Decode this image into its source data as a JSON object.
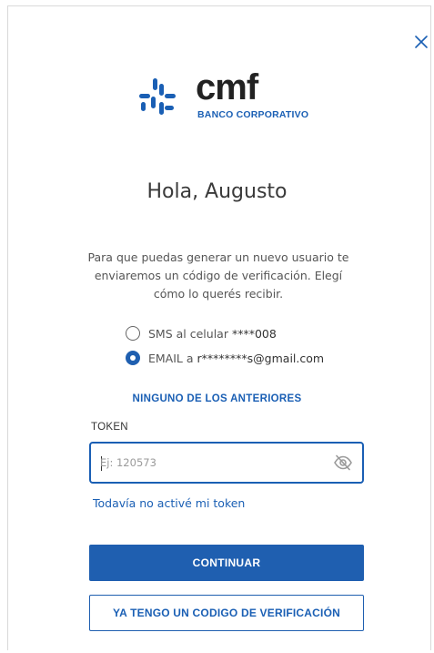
{
  "brand": {
    "name": "cmf",
    "subtitle": "BANCO CORPORATIVO",
    "color": "#1a5fb4"
  },
  "greeting": "Hola, Augusto",
  "description": "Para que puedas generar un nuevo usuario te enviaremos un código de verificación. Elegí cómo lo querés recibir.",
  "options": [
    {
      "label": "SMS al celular",
      "value": "****008",
      "selected": false
    },
    {
      "label": "EMAIL a",
      "value": "r********s@gmail.com",
      "selected": true
    }
  ],
  "none_option_label": "NINGUNO DE LOS ANTERIORES",
  "token": {
    "label": "TOKEN",
    "placeholder": "Ej: 120573",
    "value": ""
  },
  "no_token_link": "Todavía no activé mi token",
  "buttons": {
    "continue": "CONTINUAR",
    "have_code": "YA TENGO UN CODIGO DE VERIFICACIÓN"
  },
  "icons": {
    "close": "close-icon",
    "visibility": "eye-off-icon",
    "logo": "cmf-logo-icon"
  },
  "colors": {
    "accent": "#1f5fb0",
    "text": "#333333"
  }
}
